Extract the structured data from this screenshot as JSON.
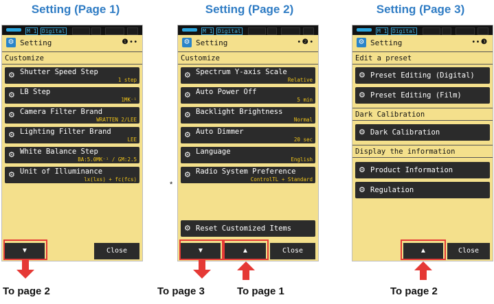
{
  "panels": [
    {
      "title": "Setting (Page 1)",
      "status": {
        "mode": "M 1",
        "meter": "Digital"
      },
      "header": {
        "title": "Setting",
        "page_indicator": "❶ • •"
      },
      "sections": [
        {
          "label": "Customize",
          "items": [
            {
              "label": "Shutter Speed Step",
              "value": "1 step"
            },
            {
              "label": "LB Step",
              "value": "1MK⁻¹"
            },
            {
              "label": "Camera Filter Brand",
              "value": "WRATTEN 2/LEE"
            },
            {
              "label": "Lighting Filter Brand",
              "value": "LEE"
            },
            {
              "label": "White Balance Step",
              "value": "BA:5.0MK⁻¹ / GM:2.5"
            },
            {
              "label": "Unit of Illuminance",
              "value": "lx(lxs) + fc(fcs)"
            }
          ]
        }
      ],
      "buttons": {
        "down": "▼",
        "close": "Close"
      },
      "caption": "To page 2"
    },
    {
      "title": "Setting (Page 2)",
      "status": {
        "mode": "M 1",
        "meter": "Digital"
      },
      "header": {
        "title": "Setting",
        "page_indicator": "• ❷ •"
      },
      "sections": [
        {
          "label": "Customize",
          "items": [
            {
              "label": "Spectrum Y-axis Scale",
              "value": "Relative"
            },
            {
              "label": "Auto Power Off",
              "value": "5 min"
            },
            {
              "label": "Backlight Brightness",
              "value": "Normal"
            },
            {
              "label": "Auto Dimmer",
              "value": "20 sec"
            },
            {
              "label": "Language",
              "value": "English"
            },
            {
              "label": "Radio System Preference",
              "value": "ControlTL + Standard"
            }
          ]
        }
      ],
      "reset_label": "Reset Customized Items",
      "asterisk": "*",
      "buttons": {
        "down": "▼",
        "up": "▲",
        "close": "Close"
      },
      "captions": {
        "down": "To page 3",
        "up": "To page 1"
      }
    },
    {
      "title": "Setting (Page 3)",
      "status": {
        "mode": "M 1",
        "meter": "Digital"
      },
      "header": {
        "title": "Setting",
        "page_indicator": "• • ❸"
      },
      "sections": [
        {
          "label": "Edit a preset",
          "items": [
            {
              "label": "Preset Editing (Digital)"
            },
            {
              "label": "Preset Editing (Film)"
            }
          ]
        },
        {
          "label": "Dark Calibration",
          "items": [
            {
              "label": "Dark Calibration"
            }
          ]
        },
        {
          "label": "Display the information",
          "items": [
            {
              "label": "Product Information"
            },
            {
              "label": "Regulation"
            }
          ]
        }
      ],
      "buttons": {
        "up": "▲",
        "close": "Close"
      },
      "caption": "To page 2"
    }
  ],
  "colors": {
    "screen_bg": "#f4e08c",
    "title_blue": "#2f7cc4",
    "highlight_red": "#e53935",
    "value_yellow": "#f0c419"
  },
  "icons": {
    "gear": "gear-icon",
    "setting": "setting-icon"
  }
}
